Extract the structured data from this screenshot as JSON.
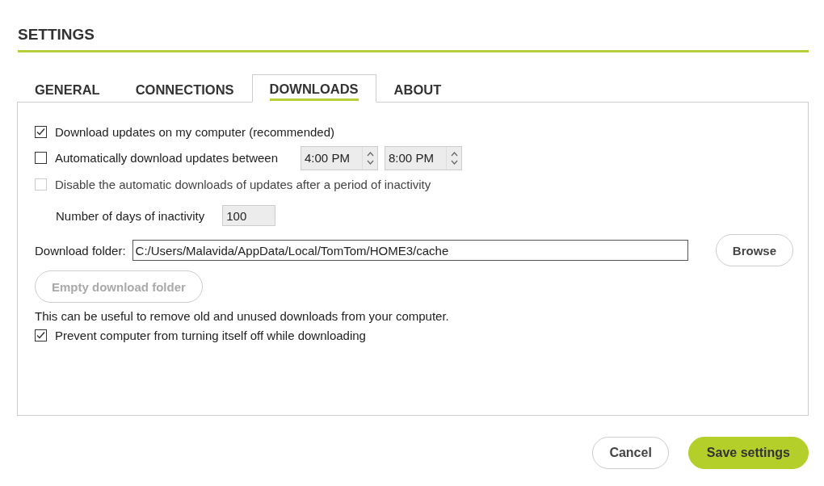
{
  "title": "SETTINGS",
  "tabs": [
    {
      "label": "GENERAL",
      "selected": false
    },
    {
      "label": "CONNECTIONS",
      "selected": false
    },
    {
      "label": "DOWNLOADS",
      "selected": true
    },
    {
      "label": "ABOUT",
      "selected": false
    }
  ],
  "options": [
    {
      "kind": "checkbox",
      "label": "Download updates on my computer (recommended)",
      "checked": true,
      "disabled": false
    },
    {
      "kind": "checkbox-times",
      "label": "Automatically download updates between",
      "checked": false,
      "disabled": false,
      "times": [
        "4:00 PM",
        "8:00 PM"
      ]
    },
    {
      "kind": "checkbox",
      "label": "Disable the automatic downloads of updates after a period of inactivity",
      "checked": false,
      "disabled": true
    },
    {
      "kind": "number",
      "label": "Number of days of inactivity",
      "value": "100"
    }
  ],
  "download_folder": {
    "label": "Download folder:",
    "value": "C:/Users/Malavida/AppData/Local/TomTom/HOME3/cache",
    "browse": "Browse"
  },
  "empty_button": {
    "label": "Empty download folder",
    "disabled": true
  },
  "note": "This can be useful to remove old and unused downloads from your computer.",
  "prevent": {
    "label": "Prevent computer from turning itself off while downloading",
    "checked": true
  },
  "buttons": [
    {
      "label": "Cancel",
      "kind": "secondary"
    },
    {
      "label": "Save settings",
      "kind": "primary"
    }
  ]
}
